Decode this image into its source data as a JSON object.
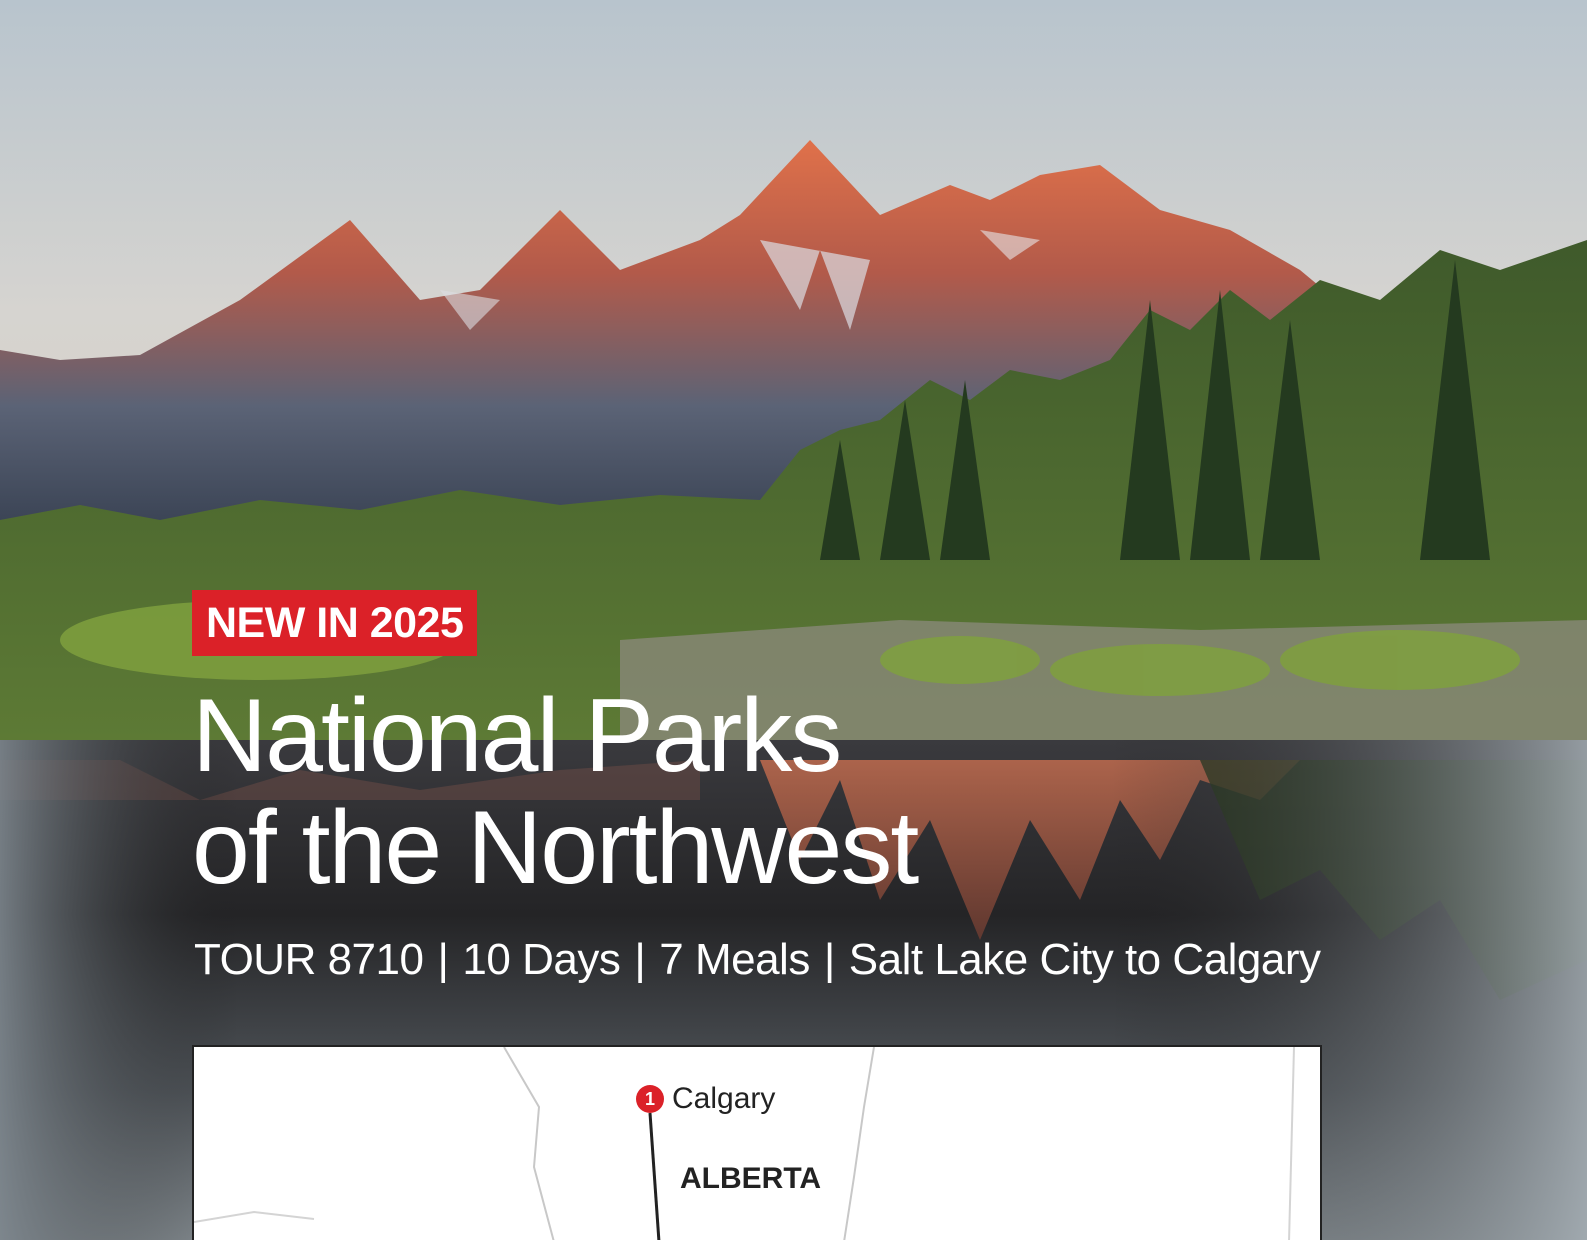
{
  "badge": {
    "label": "NEW IN 2025"
  },
  "title": {
    "line1": "National Parks",
    "line2": "of the Northwest"
  },
  "meta": {
    "tour": "TOUR 8710",
    "days": "10 Days",
    "meals": "7 Meals",
    "route": "Salt Lake City to Calgary",
    "separator": "|"
  },
  "map": {
    "stop_number": "1",
    "city": "Calgary",
    "province": "ALBERTA"
  },
  "colors": {
    "accent": "#db2128",
    "text_light": "#ffffff",
    "map_bg": "#ffffff"
  }
}
